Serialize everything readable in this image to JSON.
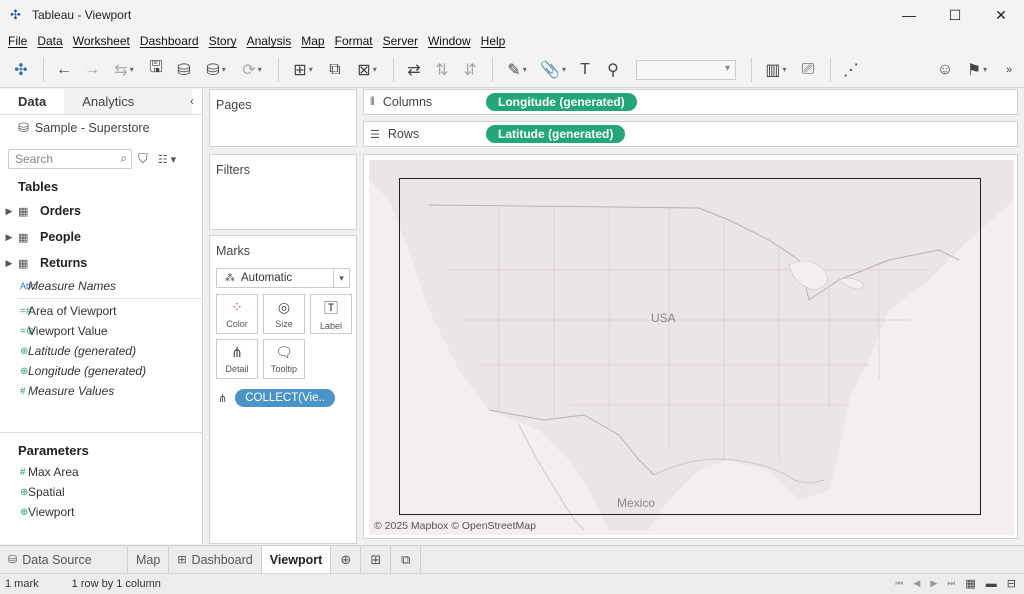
{
  "window": {
    "title": "Tableau - Viewport"
  },
  "menu": [
    "File",
    "Data",
    "Worksheet",
    "Dashboard",
    "Story",
    "Analysis",
    "Map",
    "Format",
    "Server",
    "Window",
    "Help"
  ],
  "data_pane": {
    "tabs": [
      "Data",
      "Analytics"
    ],
    "datasource": "Sample - Superstore",
    "search_placeholder": "Search",
    "tables_header": "Tables",
    "tables": [
      "Orders",
      "People",
      "Returns"
    ],
    "fields": [
      {
        "name": "Measure Names",
        "icon": "Abc",
        "italic": true
      },
      {
        "name": "Area of Viewport",
        "icon": "#",
        "italic": false
      },
      {
        "name": "Viewport Value",
        "icon": "globe-link",
        "italic": false
      },
      {
        "name": "Latitude (generated)",
        "icon": "globe",
        "italic": true
      },
      {
        "name": "Longitude (generated)",
        "icon": "globe",
        "italic": true
      },
      {
        "name": "Measure Values",
        "icon": "#",
        "italic": true
      }
    ],
    "parameters_header": "Parameters",
    "parameters": [
      {
        "name": "Max Area",
        "icon": "#"
      },
      {
        "name": "Spatial",
        "icon": "globe"
      },
      {
        "name": "Viewport",
        "icon": "globe"
      }
    ]
  },
  "shelves": {
    "pages": "Pages",
    "filters": "Filters",
    "marks": "Marks",
    "mark_type": "Automatic",
    "mark_buttons": [
      "Color",
      "Size",
      "Label",
      "Detail",
      "Tooltip"
    ],
    "detail_pill": "COLLECT(Vie..",
    "columns_label": "Columns",
    "columns_pill": "Longitude (generated)",
    "rows_label": "Rows",
    "rows_pill": "Latitude (generated)"
  },
  "view": {
    "label_usa": "USA",
    "label_mexico": "Mexico",
    "attribution": "© 2025 Mapbox © OpenStreetMap"
  },
  "sheet_tabs": {
    "datasource": "Data Source",
    "sheets": [
      "Map",
      "Dashboard",
      "Viewport"
    ],
    "active": "Viewport"
  },
  "status": {
    "marks": "1 mark",
    "dims": "1 row by 1 column"
  },
  "colors": {
    "pill_green": "#23a77a",
    "pill_blue": "#4a94c8",
    "map_bg": "#efe9ec"
  }
}
